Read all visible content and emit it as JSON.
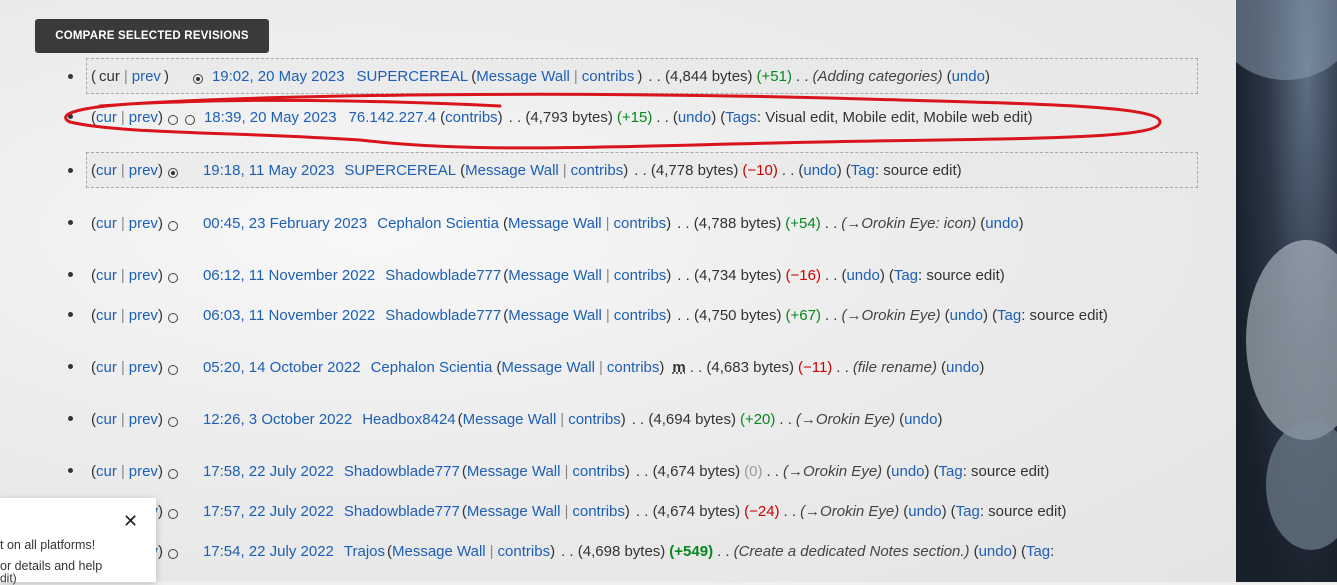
{
  "compare_button": "COMPARE SELECTED REVISIONS",
  "labels": {
    "cur": "cur",
    "prev": "prev",
    "message_wall": "Message Wall",
    "contribs": "contribs",
    "undo": "undo"
  },
  "revisions": [
    {
      "date": "19:02, 20 May 2023",
      "user": "SUPERCEREAL",
      "bytes": "(4,844 bytes)",
      "diff": "(+51)",
      "comment": "(Adding categories)",
      "tag_label": "",
      "tags": ""
    },
    {
      "date": "18:39, 20 May 2023",
      "user": "76.142.227.4",
      "bytes": "(4,793 bytes)",
      "diff": "(+15)",
      "comment": "",
      "tag_label": "Tags",
      "tags": ": Visual edit, Mobile edit, Mobile web edit)"
    },
    {
      "date": "19:18, 11 May 2023",
      "user": "SUPERCEREAL",
      "bytes": "(4,778 bytes)",
      "diff": "(−10)",
      "comment": "",
      "tag_label": "Tag",
      "tags": ": source edit)"
    },
    {
      "date": "00:45, 23 February 2023",
      "user": "Cephalon Scientia",
      "bytes": "(4,788 bytes)",
      "diff": "(+54)",
      "comment": "(→Orokin Eye: icon)",
      "tag_label": "",
      "tags": ""
    },
    {
      "date": "06:12, 11 November 2022",
      "user": "Shadowblade777",
      "bytes": "(4,734 bytes)",
      "diff": "(−16)",
      "comment": "",
      "tag_label": "Tag",
      "tags": ": source edit)"
    },
    {
      "date": "06:03, 11 November 2022",
      "user": "Shadowblade777",
      "bytes": "(4,750 bytes)",
      "diff": "(+67)",
      "comment": "(→Orokin Eye)",
      "tag_label": "Tag",
      "tags": ": source edit)"
    },
    {
      "date": "05:20, 14 October 2022",
      "user": "Cephalon Scientia",
      "bytes": "(4,683 bytes)",
      "diff": "(−11)",
      "comment": "(file rename)",
      "minor": "m",
      "tag_label": "",
      "tags": ""
    },
    {
      "date": "12:26, 3 October 2022",
      "user": "Headbox8424",
      "bytes": "(4,694 bytes)",
      "diff": "(+20)",
      "comment": "(→Orokin Eye)",
      "tag_label": "",
      "tags": ""
    },
    {
      "date": "17:58, 22 July 2022",
      "user": "Shadowblade777",
      "bytes": "(4,674 bytes)",
      "diff": "(0)",
      "comment": "(→Orokin Eye)",
      "tag_label": "Tag",
      "tags": ": source edit)"
    },
    {
      "date": "17:57, 22 July 2022",
      "user": "Shadowblade777",
      "bytes": "(4,674 bytes)",
      "diff": "(−24)",
      "comment": "(→Orokin Eye)",
      "tag_label": "Tag",
      "tags": ": source edit)"
    },
    {
      "date": "17:54, 22 July 2022",
      "user": "Trajos",
      "bytes": "(4,698 bytes)",
      "diff": "(+549)",
      "comment": "(Create a dedicated Notes section.)",
      "tag_label": "Tag",
      "tags": ":"
    }
  ],
  "toast": {
    "line1": "t on all platforms!",
    "line2": "or details and help",
    "line3": "dit)",
    "partial_prev_1": "v)",
    "partial_prev_2": "v)"
  },
  "colors": {
    "positive": "#06861e",
    "negative": "#cc0000",
    "zero": "#9a9a9a",
    "link": "#1c5fb5",
    "annotation": "#d9141b"
  }
}
